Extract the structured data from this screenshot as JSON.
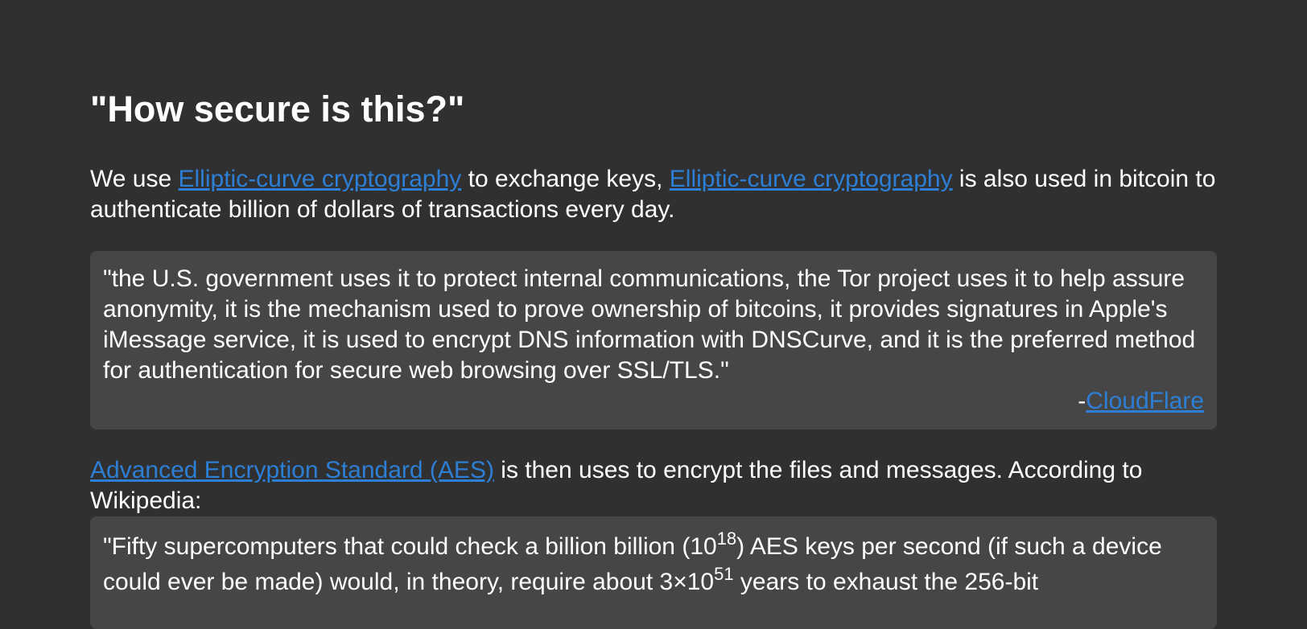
{
  "heading": "\"How secure is this?\"",
  "intro": {
    "prefix": "We use ",
    "link1": "Elliptic-curve cryptography",
    "middle": " to exchange keys, ",
    "link2": "Elliptic-curve cryptography",
    "suffix": " is also used in bitcoin to authenticate billion of dollars of transactions every day."
  },
  "quote1": {
    "text": "\"the U.S. government uses it to protect internal communications, the Tor project uses it to help assure anonymity, it is the mechanism used to prove ownership of bitcoins, it provides signatures in Apple's iMessage service, it is used to encrypt DNS information with DNSCurve, and it is the preferred method for authentication for secure web browsing over SSL/TLS.\"",
    "dash": "-",
    "source_link": "CloudFlare"
  },
  "aes": {
    "link": "Advanced Encryption Standard (AES)",
    "text": " is then uses to encrypt the files and messages. According to Wikipedia:"
  },
  "quote2": {
    "part1": "\"Fifty supercomputers that could check a billion billion (10",
    "exp1": "18",
    "part2": ") AES keys per second (if such a device could ever be made) would, in theory, require about 3×10",
    "exp2": "51",
    "part3": " years to exhaust the 256-bit"
  }
}
